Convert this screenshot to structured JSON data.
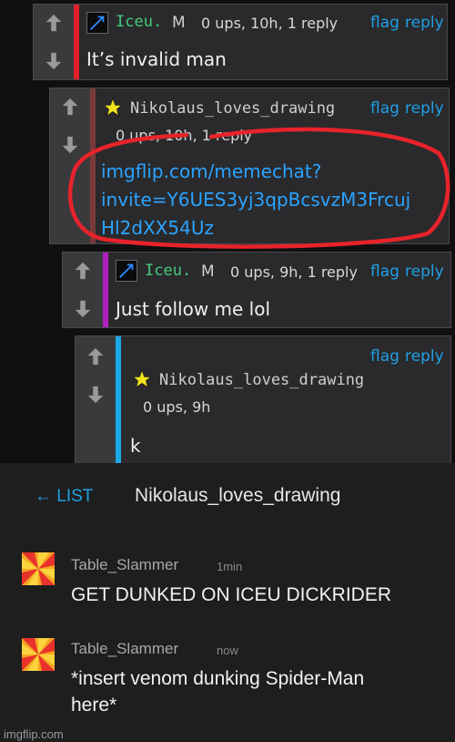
{
  "comments": [
    {
      "username": "Iceu.",
      "badge": "M",
      "meta": "0 ups, 10h, 1 reply",
      "flag": "flag",
      "reply": "reply",
      "text": "It’s invalid man",
      "bar_color": "#e0202a"
    },
    {
      "username": "Nikolaus_loves_drawing",
      "meta": "0 ups, 10h, 1 reply",
      "flag": "flag",
      "reply": "reply",
      "link_line1": "imgflip.com/memechat?",
      "link_line2": "invite=Y6UES3yj3qpBcsvzM3Frcuj",
      "link_line3": "Hl2dXX54Uz",
      "bar_color": "#7a3a3a"
    },
    {
      "username": "Iceu.",
      "badge": "M",
      "meta": "0 ups, 9h, 1 reply",
      "flag": "flag",
      "reply": "reply",
      "text": "Just follow me lol",
      "bar_color": "#b020c0"
    },
    {
      "username": "Nikolaus_loves_drawing",
      "meta": "0 ups, 9h",
      "flag": "flag",
      "reply": "reply",
      "text": "k",
      "bar_color": "#1aa8e8"
    }
  ],
  "chat": {
    "back_label": "← LIST",
    "title": "Nikolaus_loves_drawing",
    "messages": [
      {
        "name": "Table_Slammer",
        "time": "1min",
        "line1": "GET DUNKED ON ICEU DICKRIDER",
        "line2": ""
      },
      {
        "name": "Table_Slammer",
        "time": "now",
        "line1": "*insert venom dunking Spider-Man",
        "line2": "here*"
      }
    ]
  },
  "watermark": "imgflip.com",
  "colors": {
    "link": "#2ba3ff",
    "action": "#1fa0e5",
    "annotation_circle": "#e8232b"
  }
}
